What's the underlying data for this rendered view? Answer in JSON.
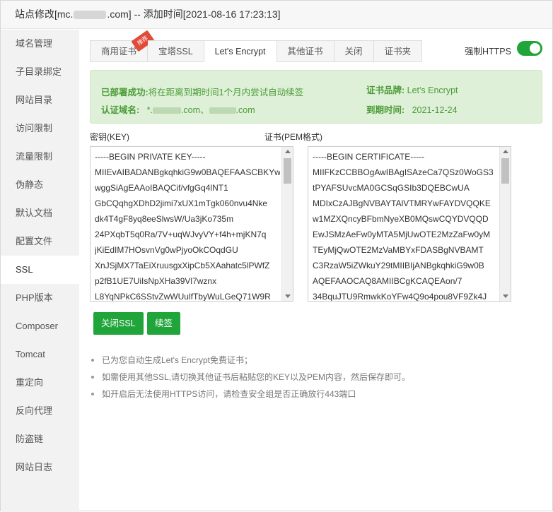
{
  "window": {
    "title_prefix": "站点修改[mc.",
    "title_suffix": ".com] -- 添加时间[2021-08-16 17:23:13]"
  },
  "sidebar": {
    "items": [
      {
        "label": "域名管理"
      },
      {
        "label": "子目录绑定"
      },
      {
        "label": "网站目录"
      },
      {
        "label": "访问限制"
      },
      {
        "label": "流量限制"
      },
      {
        "label": "伪静态"
      },
      {
        "label": "默认文档"
      },
      {
        "label": "配置文件"
      },
      {
        "label": "SSL",
        "active": true
      },
      {
        "label": "PHP版本"
      },
      {
        "label": "Composer"
      },
      {
        "label": "Tomcat"
      },
      {
        "label": "重定向"
      },
      {
        "label": "反向代理"
      },
      {
        "label": "防盗链"
      },
      {
        "label": "网站日志"
      }
    ]
  },
  "tabs": [
    {
      "label": "商用证书",
      "badge": "推荐"
    },
    {
      "label": "宝塔SSL"
    },
    {
      "label": "Let's Encrypt",
      "active": true
    },
    {
      "label": "其他证书"
    },
    {
      "label": "关闭"
    },
    {
      "label": "证书夹"
    }
  ],
  "force_https": {
    "label": "强制HTTPS",
    "enabled": true
  },
  "status": {
    "deploy_key": "已部署成功:",
    "deploy_value": "将在距离到期时间1个月内尝试自动续签",
    "brand_key": "证书品牌:",
    "brand_value": "Let's Encrypt",
    "domain_key": "认证域名:",
    "domain_value_1": "*.",
    "domain_value_2": ".com、",
    "domain_value_3": ".com",
    "expire_key": "到期时间:",
    "expire_value": "2021-12-24"
  },
  "key_field": {
    "label": "密钥(KEY)",
    "lines": [
      "-----BEGIN PRIVATE KEY-----",
      "MIIEvAIBADANBgkqhkiG9w0BAQEFAASCBKYwggSiAgEAAoIBAQCif",
      "wggSiAgEAAoIBAQCif/vfgGq4lNT1",
      "GbCQqhgXDhD2jimi7xUX1mTgk060nvu4Nke",
      "dk4T4gF8yq8eeSlwsW/Ua3jKo735m",
      "24PXqbT5q0Ra/7V+uqWJvyVY+f4h+mjKN7q",
      "jKiEdIM7HOsvnVg0wPjyoOkCOqdGU",
      "XnJSjMX7TaEiXruusgxXipCb5XAahatc5lPWfZ",
      "p2fB1UE7UiIsNpXHa39Vl7wznx",
      "L8YqNPkC6SStvZwWUulfTbyWuLGeQ71W9R"
    ]
  },
  "cert_field": {
    "label": "证书(PEM格式)",
    "lines": [
      "-----BEGIN CERTIFICATE-----",
      "MIIFKzCCBBOgAwIBAgISAzeCa7QSz0WoGS3",
      "tPYAFSUvcMA0GCSqGSIb3DQEBCwUA",
      "MDIxCzAJBgNVBAYTAlVTMRYwFAYDVQQKE",
      "w1MZXQncyBFbmNyeXB0MQswCQYDVQQD",
      "EwJSMzAeFw0yMTA5MjUwOTE2MzZaFw0yM",
      "TEyMjQwOTE2MzVaMBYxFDASBgNVBAMT",
      "C3RzaW5iZWkuY29tMIIBIjANBgkqhkiG9w0B",
      "AQEFAAOCAQ8AMIIBCgKCAQEAon/7",
      "34BquJTU9RmwkKoYFw4Q9o4pou8VF9Zk4J"
    ]
  },
  "buttons": {
    "close_ssl": "关闭SSL",
    "renew": "续签"
  },
  "tips": [
    "已为您自动生成Let's Encrypt免费证书；",
    "如需使用其他SSL,请切换其他证书后粘贴您的KEY以及PEM内容，然后保存即可。",
    "如开启后无法使用HTTPS访问，请检查安全组是否正确放行443端口"
  ],
  "colors": {
    "accent": "#20a53a",
    "success_bg": "#dff0d8",
    "success_text": "#4a9b37",
    "badge": "#e04b3a"
  }
}
